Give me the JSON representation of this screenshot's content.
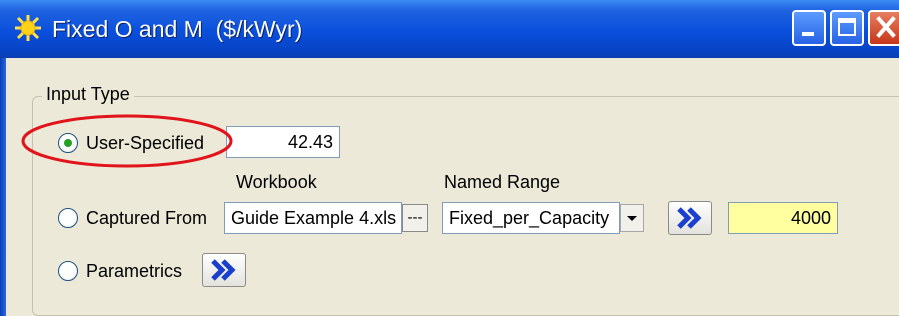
{
  "window": {
    "title": "Fixed O and M  ($/kWyr)",
    "icon": "sun-icon",
    "controls": [
      "minimize",
      "maximize",
      "close"
    ]
  },
  "group": {
    "legend": "Input Type"
  },
  "user_specified": {
    "label": "User-Specified",
    "selected": true,
    "value": "42.43",
    "annotation": "red-ellipse-highlight"
  },
  "captured_from": {
    "label": "Captured From",
    "selected": false,
    "workbook_header": "Workbook",
    "workbook_value": "Guide Example 4.xls",
    "browse_label": "---",
    "named_range_header": "Named Range",
    "named_range_value": "Fixed_per_Capacity",
    "go_icon": "double-chevron-right-icon",
    "result_value": "4000"
  },
  "parametrics": {
    "label": "Parametrics",
    "selected": false,
    "go_icon": "double-chevron-right-icon"
  },
  "colors": {
    "titlebar": "#0a4fdc",
    "window_bg": "#ece9d8",
    "highlight_value_bg": "#ffffa0",
    "annotation_red": "#e0141a",
    "chevron_blue": "#1a3fcf"
  }
}
